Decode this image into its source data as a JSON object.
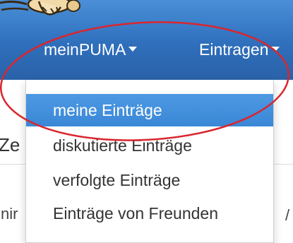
{
  "navbar": {
    "logo_icon": "mascot-logo-icon",
    "items": [
      {
        "label": "meinPUMA",
        "icon": "caret-down-icon"
      },
      {
        "label": "Eintragen",
        "icon": "caret-down-icon"
      }
    ]
  },
  "dropdown": {
    "items": [
      {
        "label": "meine Einträge",
        "active": true
      },
      {
        "label": "diskutierte Einträge",
        "active": false
      },
      {
        "label": "verfolgte Einträge",
        "active": false
      },
      {
        "label": "Einträge von Freunden",
        "active": false
      }
    ]
  },
  "page": {
    "heading_fragment": "Ze",
    "text_fragment": "nir",
    "slash_fragment": "/"
  },
  "annotation": {
    "color": "#d9262e"
  },
  "colors": {
    "navbar": "#2f6fbc",
    "active_item": "#3a87d6"
  }
}
